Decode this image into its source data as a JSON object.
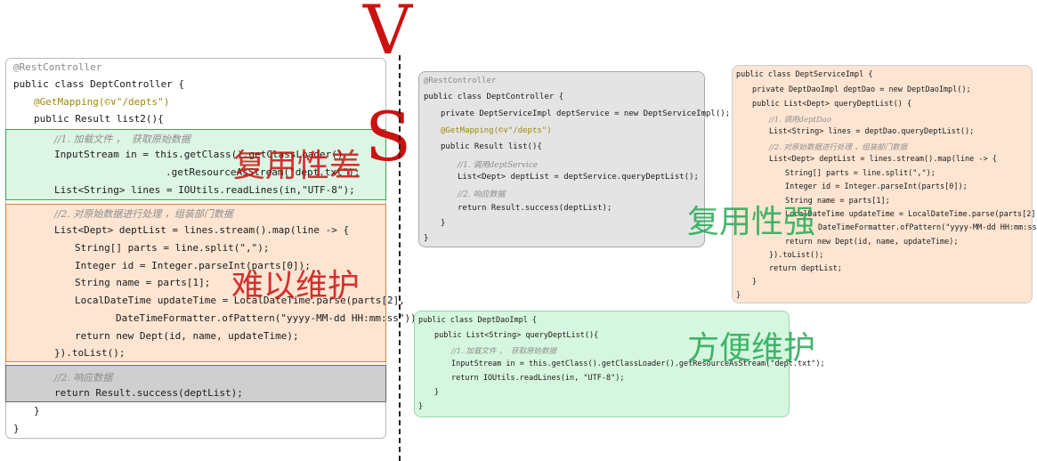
{
  "left": {
    "annotation": "@RestController",
    "class_decl": "public class DeptController {",
    "mapping": "@GetMapping(©∨\"/depts\")",
    "method_decl": "public Result list2(){",
    "comment1": "//1. 加载文件 ，  获取原始数据",
    "line_stream1": "InputStream in = this.getClass().getClassLoader()",
    "line_stream2": ".getResourceAsStream(\"dept.txt\");",
    "line_lines": "List<String> lines = IOUtils.readLines(in,\"UTF-8\");",
    "comment2": "//2. 对原始数据进行处理 ，组装部门数据",
    "line_map": "List<Dept> deptList = lines.stream().map(line -> {",
    "line_split": "String[] parts = line.split(\",\");",
    "line_id": "Integer id = Integer.parseInt(parts[0]);",
    "line_name": "String name = parts[1];",
    "line_time1": "LocalDateTime updateTime = LocalDateTime.parse(parts[2],",
    "line_time2": "DateTimeFormatter.ofPattern(\"yyyy-MM-dd HH:mm:ss\"));",
    "line_return_dept": "return new Dept(id, name, updateTime);",
    "line_tolist": "}).toList();",
    "comment3": "//2. 响应数据",
    "line_return": "return Result.success(deptList);",
    "close_method": "}",
    "close_class": "}"
  },
  "overlays": {
    "reuse_poor": "复用性差",
    "hard_maintain": "难以维护",
    "reuse_good": "复用性强",
    "easy_maintain": "方便维护"
  },
  "vs": {
    "v": "V",
    "s": "S"
  },
  "controller": {
    "annotation": "@RestController",
    "class_decl": "public class DeptController {",
    "field": "private DeptServiceImpl deptService = new DeptServiceImpl();",
    "mapping": "@GetMapping(©∨\"/depts\")",
    "method_decl": "public Result list(){",
    "comment1": "//1. 调用deptService",
    "line_call": "List<Dept> deptList = deptService.queryDeptList();",
    "comment2": "//2. 响应数据",
    "line_return": "return Result.success(deptList);",
    "close_method": "}",
    "close_class": "}"
  },
  "service": {
    "class_decl": "public class DeptServiceImpl {",
    "field": "private DeptDaoImpl deptDao = new DeptDaoImpl();",
    "method_decl": "public List<Dept> queryDeptList() {",
    "comment1": "//1. 调用deptDao",
    "line_lines": "List<String> lines = deptDao.queryDeptList();",
    "comment2": "//2. 对原始数据进行处理 ，组装部门数据",
    "line_map": "List<Dept> deptList = lines.stream().map(line -> {",
    "line_split": "String[] parts = line.split(\",\");",
    "line_id": "Integer id = Integer.parseInt(parts[0]);",
    "line_name": "String name = parts[1];",
    "line_time1": "LocalDateTime updateTime = LocalDateTime.parse(parts[2],",
    "line_time2": "DateTimeFormatter.ofPattern(\"yyyy-MM-dd HH:mm:ss\"));",
    "line_return_dept": "return new Dept(id, name, updateTime);",
    "line_tolist": "}).toList();",
    "line_return": "return deptList;",
    "close_method": "}",
    "close_class": "}"
  },
  "dao": {
    "class_decl": "public class DeptDaoImpl {",
    "method_decl": "public List<String> queryDeptList(){",
    "comment1": "//1. 加载文件 ，  获取原始数据",
    "line_stream": "InputStream in = this.getClass().getClassLoader().getResourceAsStream(\"dept.txt\");",
    "line_return": "return IOUtils.readLines(in, \"UTF-8\");",
    "close_method": "}",
    "close_class": "}"
  },
  "colors": {
    "green_block": "#dcf5e4",
    "orange_block": "#fde5d2",
    "gray_block": "#cfcfcf",
    "controller_bg": "#e4e4e4",
    "service_bg": "#fde5d2",
    "dao_bg": "#d6f7df",
    "overlay_red": "#cc1111",
    "overlay_green": "#22aa55"
  }
}
